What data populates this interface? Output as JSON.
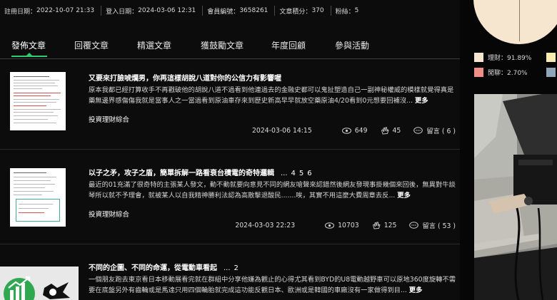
{
  "stats": [
    {
      "label": "註冊日期",
      "value": "2022-10-07 21:33"
    },
    {
      "label": "登入日期",
      "value": "2024-03-06 12:31"
    },
    {
      "label": "會員編號",
      "value": "3658261"
    },
    {
      "label": "文章積分",
      "value": "370"
    },
    {
      "label": "粉絲",
      "value": "5"
    }
  ],
  "tabs": [
    "發佈文章",
    "回覆文章",
    "精選文章",
    "獲鼓勵文章",
    "年度回顧",
    "參與活動"
  ],
  "articles": [
    {
      "title": "又要來打臉唬爛男，你再這樣胡說八道對你的公信力有影響喔",
      "pages": [],
      "excerpt_line1": "原本我都已經打算收手不再戳破他的胡說八道不過看到他連過去的金融史都可以鬼扯塑造自己一副神秘權威的模樣就覺得真是",
      "excerpt_line2": "藥無邊界感傷傷我就是當事人之一當過看到原油車存來到歷史新高早早就放空藥原油4/20看到0元想要回補沒...",
      "more": "更多",
      "category": "投資理財綜合",
      "date": "2024-03-06 14:15",
      "views": "649",
      "likes": "45",
      "comments": "留言 ( 6 )"
    },
    {
      "title": "以子之矛，攻子之盾，簡單拆解一路看衰台積電的奇特邏輯",
      "pages": [
        "...",
        "4",
        "5",
        "6"
      ],
      "excerpt_line1": "最近的01充滿了很奇特的主張某人發文，動不動就要向意見不同的網友嗆聲來認錯然後網友發現事掛幾個來回後，無異對牛談",
      "excerpt_line2": "琴所以就不予理會，就被某人以自我精神勝利法認為高散擊退酸民.......唉，其實不用這麼大費周章去反...",
      "more": "更多",
      "category": "投資理財綜合",
      "date": "2024-03-03 22:23",
      "views": "10703",
      "likes": "125",
      "comments": "留言 ( 53 )"
    },
    {
      "title": "不同的企圖、不同的命運，從電動車看起",
      "pages": [
        "...",
        "2"
      ],
      "excerpt_line1": "一個朋友跑去東京看日本移動展看完就在群組中分享他嫌為觀止的心得尤其看到BYD的U8電動越野車可以原地360度旋轉不需",
      "excerpt_line2": "要在底盤另外有齒輪或是馬達只用四個輪胎就完成這功能反觀日本、歐洲或是韓國的車廠沒有一家做得到目...",
      "more": "更多"
    }
  ],
  "sidebar": {
    "legend": [
      {
        "label": "理財：91.89%",
        "color": "#f6e5cf"
      },
      {
        "label": "閒聊：2.70%",
        "color": "#ee8e86"
      }
    ],
    "legend_extra_colors": [
      "#f6ecb0",
      "#8fa6b8"
    ]
  },
  "colors": {
    "accent": "#2ecc71",
    "background": "#0c0c0c"
  }
}
